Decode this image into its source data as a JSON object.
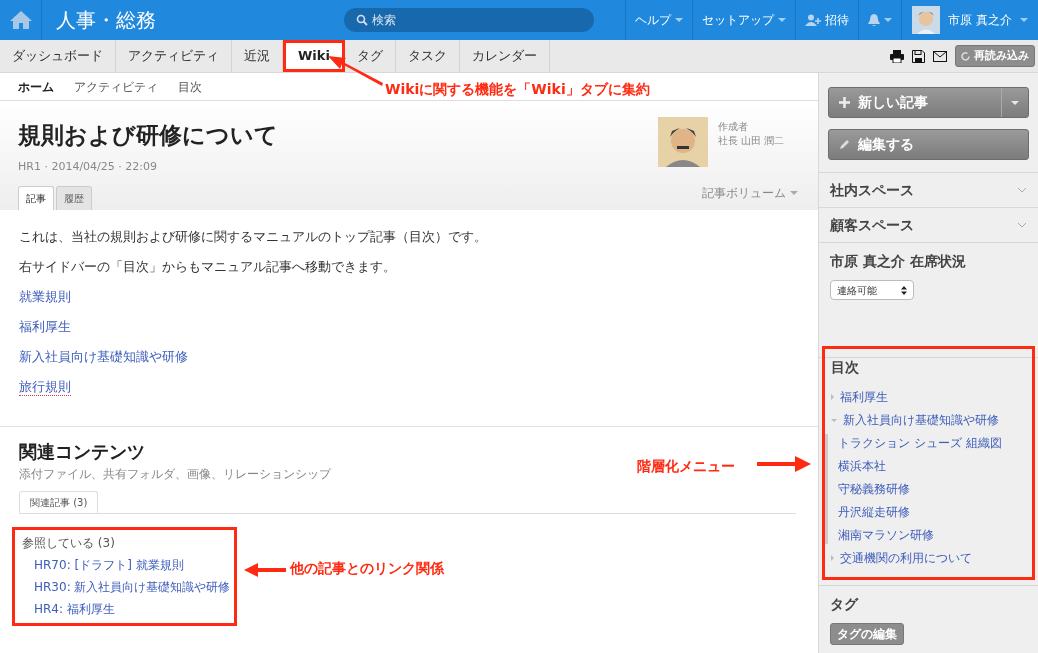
{
  "header": {
    "title": "人事・総務",
    "search": {
      "placeholder": "検索"
    },
    "menus": [
      {
        "label": "ヘルプ",
        "kind": "dropdown"
      },
      {
        "label": "セットアップ",
        "kind": "dropdown"
      },
      {
        "label": "招待",
        "kind": "invite"
      },
      {
        "kind": "bell"
      }
    ],
    "user": {
      "name": "市原 真之介"
    }
  },
  "tabs": [
    {
      "label": "ダッシュボード",
      "selected": false,
      "highlighted": false
    },
    {
      "label": "アクティビティ",
      "selected": false,
      "highlighted": false
    },
    {
      "label": "近況",
      "selected": false,
      "highlighted": false
    },
    {
      "label": "Wiki",
      "selected": true,
      "highlighted": true
    },
    {
      "label": "タグ",
      "selected": false,
      "highlighted": false
    },
    {
      "label": "タスク",
      "selected": false,
      "highlighted": false
    },
    {
      "label": "カレンダー",
      "selected": false,
      "highlighted": false
    }
  ],
  "toolbar": {
    "reload_button": "再読み込み"
  },
  "subnav": [
    {
      "label": "ホーム",
      "selected": true
    },
    {
      "label": "アクティビティ",
      "selected": false
    },
    {
      "label": "目次",
      "selected": false
    }
  ],
  "article": {
    "title": "規則および研修について",
    "meta": "HR1 · 2014/04/25 · 22:09",
    "author_label": "作成者",
    "author": "社長 山田 潤二",
    "volume_menu": "記事ボリューム",
    "tabs": [
      {
        "label": "記事",
        "selected": true
      },
      {
        "label": "履歴",
        "selected": false
      }
    ],
    "body": [
      {
        "kind": "text",
        "text": "これは、当社の規則および研修に関するマニュアルのトップ記事（目次）です。"
      },
      {
        "kind": "text",
        "text": "右サイドバーの「目次」からもマニュアル記事へ移動できます。"
      },
      {
        "kind": "link",
        "text": "就業規則"
      },
      {
        "kind": "link",
        "text": "福利厚生"
      },
      {
        "kind": "link",
        "text": "新入社員向け基礎知識や研修"
      },
      {
        "kind": "missing_link",
        "text": "旅行規則"
      }
    ]
  },
  "related": {
    "title": "関連コンテンツ",
    "subtitle": "添付ファイル、共有フォルダ、画像、リレーションシップ",
    "tabs": [
      {
        "label": "関連記事 (3)",
        "selected": true
      }
    ],
    "highlighted": true,
    "group_label": "参照している (3)",
    "links": [
      "HR70: [ドラフト] 就業規則",
      "HR30: 新入社員向け基礎知識や研修",
      "HR4: 福利厚生"
    ]
  },
  "sidebar": {
    "new_button": "新しい記事",
    "edit_button": "編集する",
    "sections": [
      {
        "label": "社内スペース",
        "expanded": false
      },
      {
        "label": "顧客スペース",
        "expanded": false
      }
    ],
    "presence": {
      "title": "市原 真之介 在席状況",
      "value": "連絡可能"
    },
    "toc": {
      "title": "目次",
      "highlighted": true,
      "items": [
        {
          "label": "福利厚生",
          "expanded": false
        },
        {
          "label": "新入社員向け基礎知識や研修",
          "expanded": true,
          "children": [
            {
              "label": "トラクション シューズ 組織図"
            },
            {
              "label": "横浜本社"
            },
            {
              "label": "守秘義務研修"
            },
            {
              "label": "丹沢縦走研修"
            },
            {
              "label": "湘南マラソン研修"
            }
          ]
        },
        {
          "label": "交通機関の利用について",
          "expanded": false
        }
      ]
    },
    "tags": {
      "title": "タグ",
      "edit_button": "タグの編集"
    }
  },
  "annotations": [
    {
      "text": "Wikiに関する機能を「Wiki」タブに集約"
    },
    {
      "text": "階層化メニュー"
    },
    {
      "text": "他の記事とのリンク関係"
    }
  ]
}
